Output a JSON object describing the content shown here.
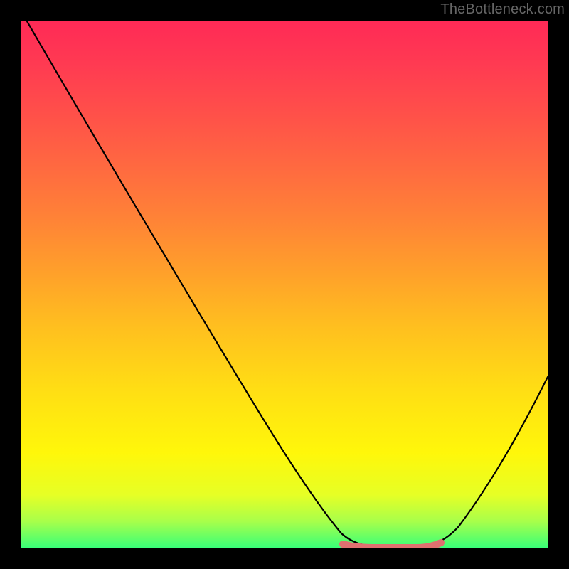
{
  "attribution": "TheBottleneck.com",
  "chart_data": {
    "type": "line",
    "title": "",
    "xlabel": "",
    "ylabel": "",
    "xlim": [
      0,
      100
    ],
    "ylim": [
      0,
      100
    ],
    "grid": false,
    "x": [
      0,
      5,
      10,
      15,
      20,
      25,
      30,
      35,
      40,
      45,
      50,
      55,
      60,
      63,
      66,
      70,
      74,
      78,
      82,
      86,
      90,
      94,
      100
    ],
    "values": [
      100,
      94,
      87,
      80,
      73,
      66,
      59,
      52,
      44,
      36,
      28,
      20,
      12,
      6,
      2,
      0,
      0,
      0,
      2,
      6,
      12,
      20,
      34
    ],
    "annotations": [
      {
        "type": "flat-region",
        "x_start": 63,
        "x_end": 80,
        "y": 0,
        "color": "#e07070"
      }
    ],
    "background_gradient": {
      "orientation": "vertical",
      "stops": [
        {
          "pos": 0.0,
          "color": "#ff2a56"
        },
        {
          "pos": 0.5,
          "color": "#ffbf1f"
        },
        {
          "pos": 0.85,
          "color": "#fff70a"
        },
        {
          "pos": 1.0,
          "color": "#39ff78"
        }
      ]
    }
  }
}
